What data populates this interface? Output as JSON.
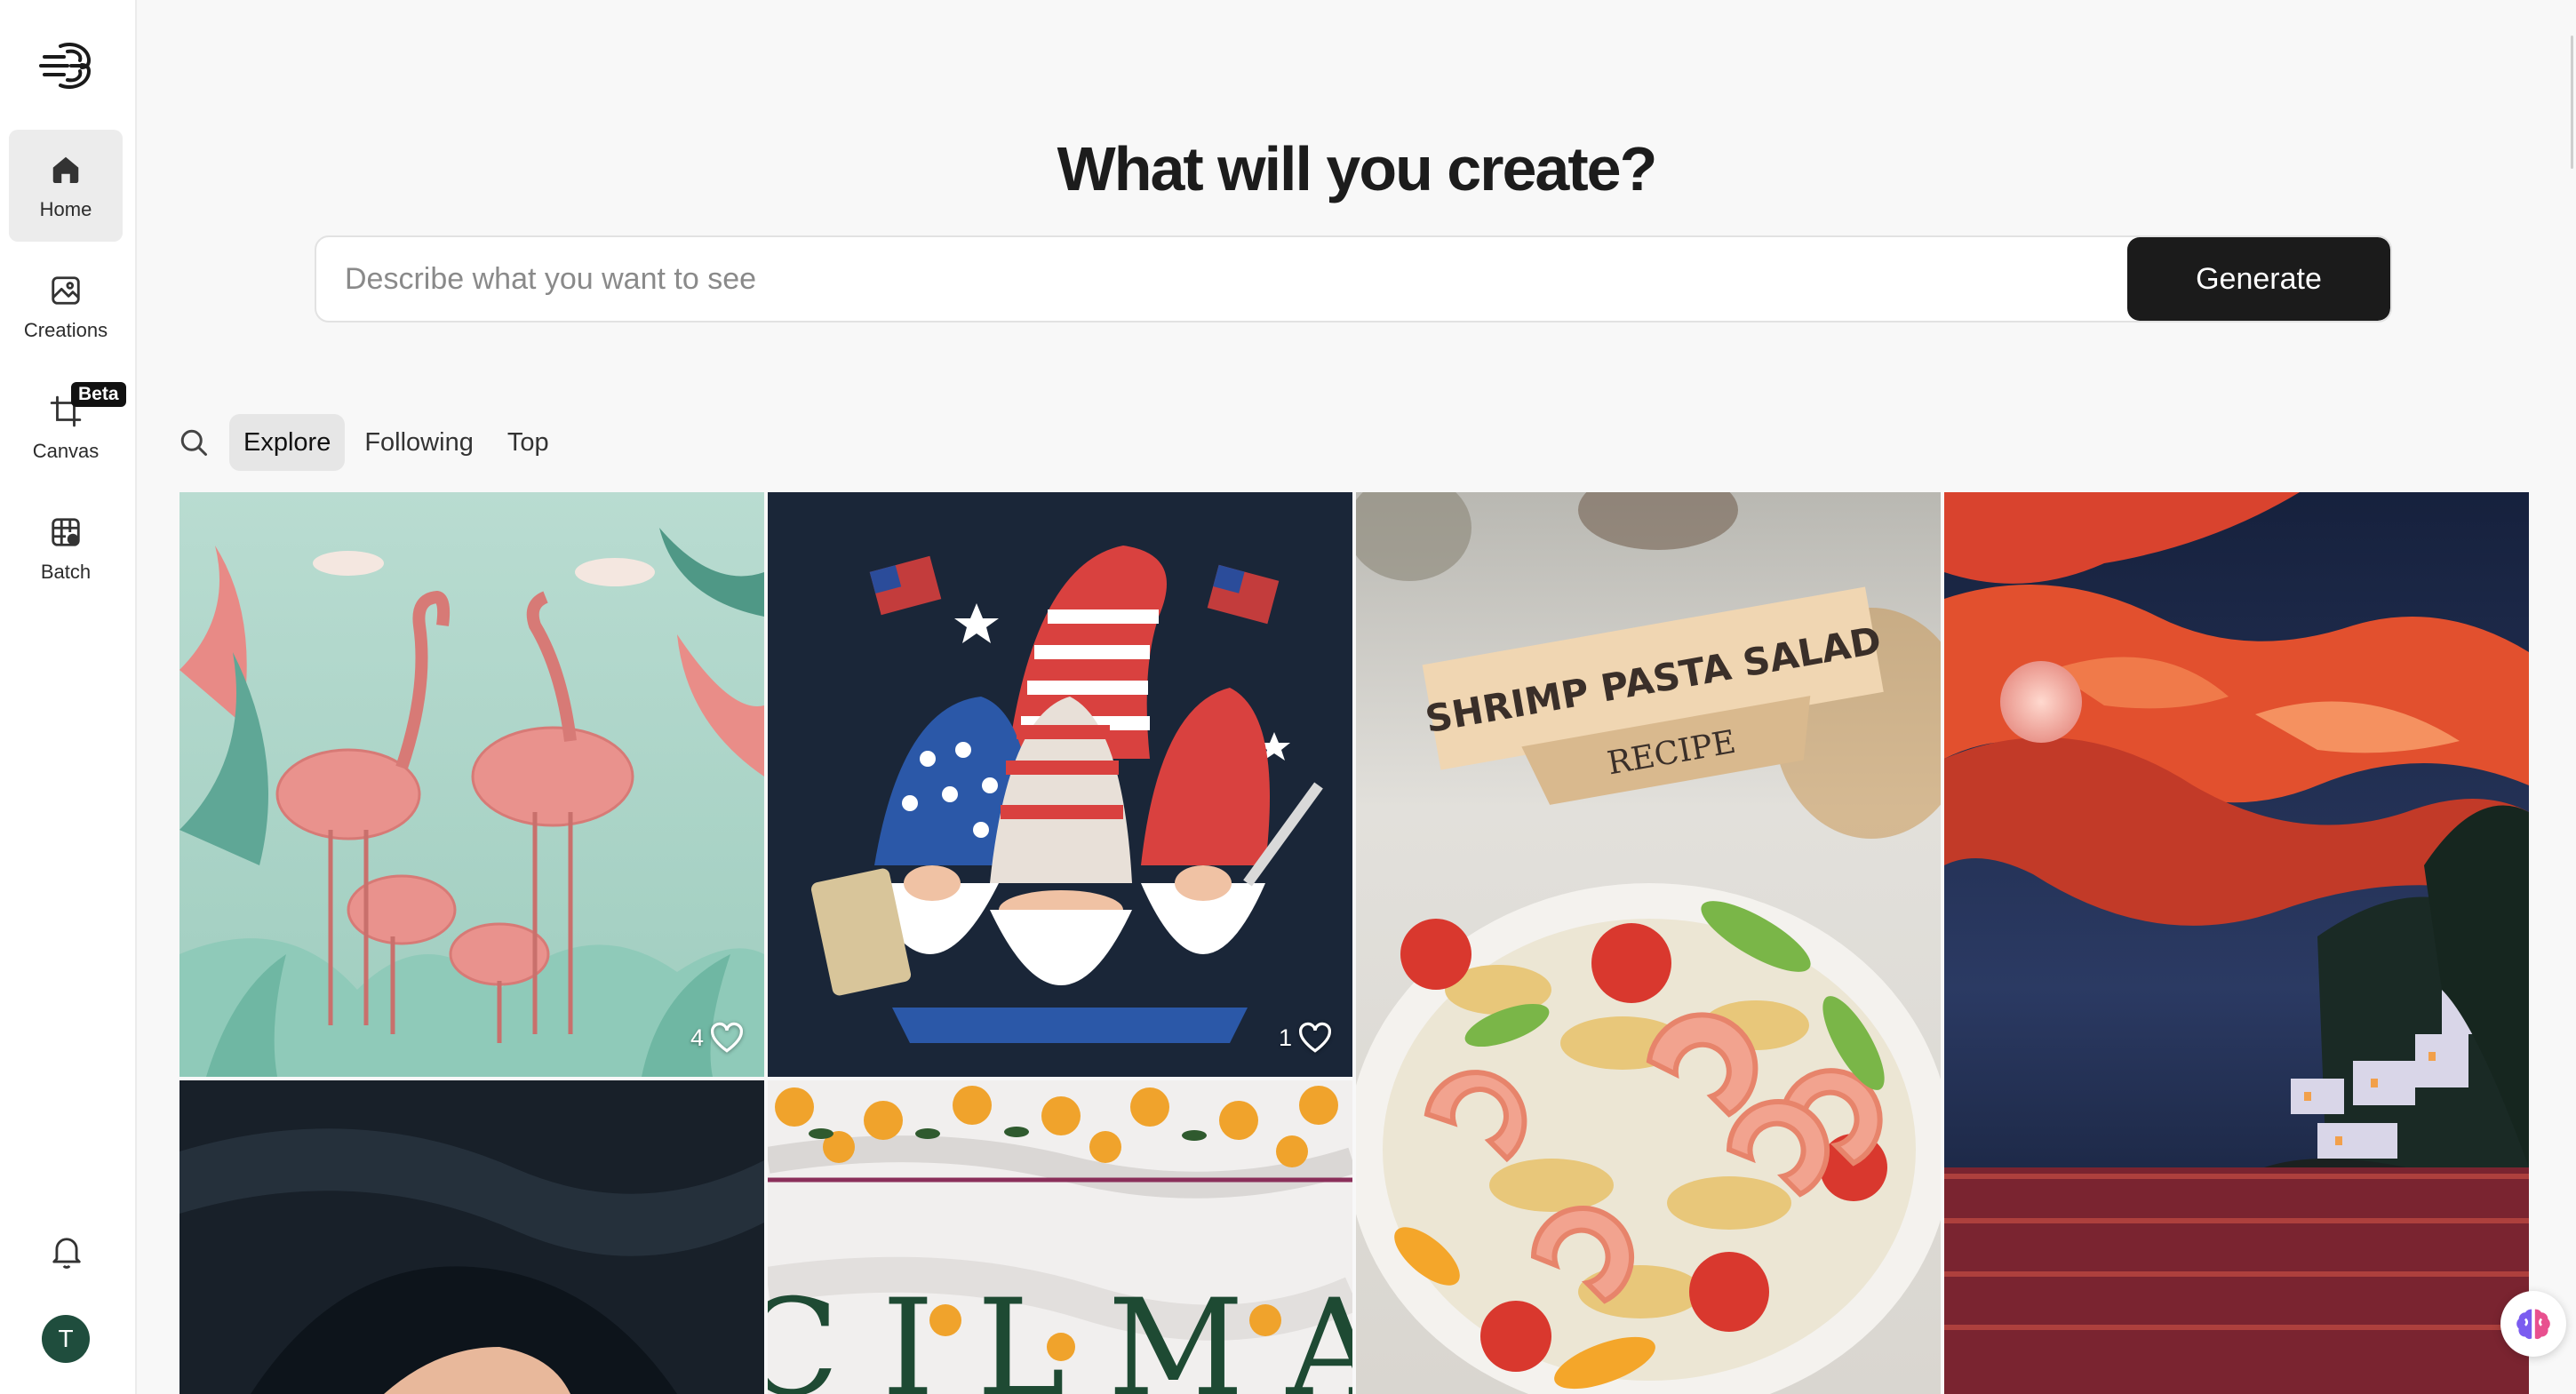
{
  "sidebar": {
    "items": [
      {
        "label": "Home",
        "icon": "home-icon"
      },
      {
        "label": "Creations",
        "icon": "image-icon"
      },
      {
        "label": "Canvas",
        "icon": "crop-icon"
      },
      {
        "label": "Batch",
        "icon": "grid-table-icon"
      }
    ],
    "canvas_badge": "Beta",
    "avatar_initial": "T"
  },
  "hero": {
    "title": "What will you create?",
    "prompt_placeholder": "Describe what you want to see",
    "generate_label": "Generate"
  },
  "tabs": [
    {
      "label": "Explore",
      "active": true
    },
    {
      "label": "Following",
      "active": false
    },
    {
      "label": "Top",
      "active": false
    }
  ],
  "gallery": [
    {
      "likes": "4"
    },
    {
      "likes": "1"
    },
    {
      "banner_line1": "SHRIMP PASTA SALAD",
      "banner_line2": "RECIPE"
    },
    {},
    {},
    {
      "text": "C I L M A"
    }
  ],
  "colors": {
    "accent": "#1b1b1b",
    "sidebar_active": "#ececec",
    "avatar": "#1f4d3d"
  }
}
